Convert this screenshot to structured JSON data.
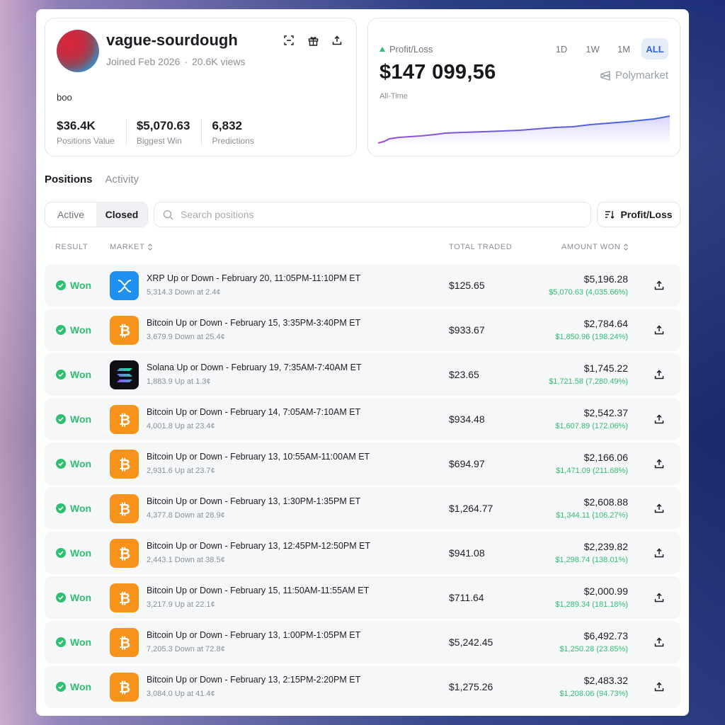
{
  "profile": {
    "username": "vague-sourdough",
    "joined": "Joined Feb 2026",
    "views": "20.6K views",
    "bio": "boo",
    "stats": [
      {
        "value": "$36.4K",
        "label": "Positions Value"
      },
      {
        "value": "$5,070.63",
        "label": "Biggest Win"
      },
      {
        "value": "6,832",
        "label": "Predictions"
      }
    ]
  },
  "pnl": {
    "title": "Profit/Loss",
    "value": "$147 099,56",
    "sub": "All-Time",
    "ranges": [
      "1D",
      "1W",
      "1M",
      "ALL"
    ],
    "active_range": "ALL",
    "brand": "Polymarket"
  },
  "tabs": {
    "positions": "Positions",
    "activity": "Activity"
  },
  "toggle": {
    "active": "Active",
    "closed": "Closed"
  },
  "search": {
    "placeholder": "Search positions"
  },
  "sort": {
    "label": "Profit/Loss"
  },
  "table": {
    "headers": {
      "result": "RESULT",
      "market": "MARKET",
      "total_traded": "TOTAL TRADED",
      "amount_won": "AMOUNT WON"
    },
    "rows": [
      {
        "result": "Won",
        "icon": "xrp",
        "title": "XRP Up or Down - February 20, 11:05PM-11:10PM ET",
        "sub": "5,314.3 Down at 2.4¢",
        "traded": "$125.65",
        "won": "$5,196.28",
        "pnl": "$5,070.63 (4,035.66%)"
      },
      {
        "result": "Won",
        "icon": "btc",
        "title": "Bitcoin Up or Down - February 15, 3:35PM-3:40PM ET",
        "sub": "3,679.9 Down at 25.4¢",
        "traded": "$933.67",
        "won": "$2,784.64",
        "pnl": "$1,850.96 (198.24%)"
      },
      {
        "result": "Won",
        "icon": "sol",
        "title": "Solana Up or Down - February 19, 7:35AM-7:40AM ET",
        "sub": "1,883.9 Up at 1.3¢",
        "traded": "$23.65",
        "won": "$1,745.22",
        "pnl": "$1,721.58 (7,280.49%)"
      },
      {
        "result": "Won",
        "icon": "btc",
        "title": "Bitcoin Up or Down - February 14, 7:05AM-7:10AM ET",
        "sub": "4,001.8 Up at 23.4¢",
        "traded": "$934.48",
        "won": "$2,542.37",
        "pnl": "$1,607.89 (172.06%)"
      },
      {
        "result": "Won",
        "icon": "btc",
        "title": "Bitcoin Up or Down - February 13, 10:55AM-11:00AM ET",
        "sub": "2,931.6 Up at 23.7¢",
        "traded": "$694.97",
        "won": "$2,166.06",
        "pnl": "$1,471.09 (211.68%)"
      },
      {
        "result": "Won",
        "icon": "btc",
        "title": "Bitcoin Up or Down - February 13, 1:30PM-1:35PM ET",
        "sub": "4,377.8 Down at 28.9¢",
        "traded": "$1,264.77",
        "won": "$2,608.88",
        "pnl": "$1,344.11 (106.27%)"
      },
      {
        "result": "Won",
        "icon": "btc",
        "title": "Bitcoin Up or Down - February 13, 12:45PM-12:50PM ET",
        "sub": "2,443.1 Down at 38.5¢",
        "traded": "$941.08",
        "won": "$2,239.82",
        "pnl": "$1,298.74 (138.01%)"
      },
      {
        "result": "Won",
        "icon": "btc",
        "title": "Bitcoin Up or Down - February 15, 11:50AM-11:55AM ET",
        "sub": "3,217.9 Up at 22.1¢",
        "traded": "$711.64",
        "won": "$2,000.99",
        "pnl": "$1,289.34 (181.18%)"
      },
      {
        "result": "Won",
        "icon": "btc",
        "title": "Bitcoin Up or Down - February 13, 1:00PM-1:05PM ET",
        "sub": "7,205.3 Down at 72.8¢",
        "traded": "$5,242.45",
        "won": "$6,492.73",
        "pnl": "$1,250.28 (23.85%)"
      },
      {
        "result": "Won",
        "icon": "btc",
        "title": "Bitcoin Up or Down - February 13, 2:15PM-2:20PM ET",
        "sub": "3,084.0 Up at 41.4¢",
        "traded": "$1,275.26",
        "won": "$2,483.32",
        "pnl": "$1,208.06 (94.73%)"
      }
    ]
  },
  "colors": {
    "accent": "#2f63d8",
    "positive": "#2fbf71",
    "bitcoin": "#f7931a",
    "xrp": "#1f8ff0"
  }
}
